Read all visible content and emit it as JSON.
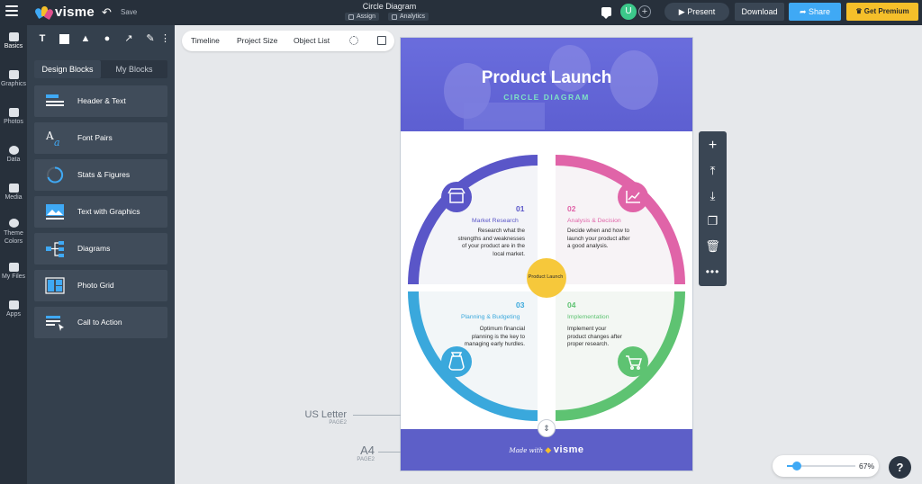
{
  "header": {
    "logo_text": "visme",
    "save_label": "Save",
    "document_title": "Circle Diagram",
    "assign_label": "Assign",
    "analytics_label": "Analytics",
    "avatar_initial": "U",
    "present_label": "Present",
    "download_label": "Download",
    "share_label": "Share",
    "premium_label": "Get Premium"
  },
  "rail": {
    "items": [
      {
        "label": "Basics"
      },
      {
        "label": "Graphics"
      },
      {
        "label": "Photos"
      },
      {
        "label": "Data"
      },
      {
        "label": "Media"
      },
      {
        "label": "Theme Colors"
      },
      {
        "label": "My Files"
      },
      {
        "label": "Apps"
      }
    ]
  },
  "panel": {
    "tab_design_blocks": "Design Blocks",
    "tab_my_blocks": "My Blocks",
    "blocks": [
      {
        "label": "Header & Text",
        "icon": "header-text-icon"
      },
      {
        "label": "Font Pairs",
        "icon": "font-pairs-icon"
      },
      {
        "label": "Stats & Figures",
        "icon": "stats-icon"
      },
      {
        "label": "Text with Graphics",
        "icon": "text-graphics-icon"
      },
      {
        "label": "Diagrams",
        "icon": "diagrams-icon"
      },
      {
        "label": "Photo Grid",
        "icon": "photo-grid-icon"
      },
      {
        "label": "Call to Action",
        "icon": "cta-icon"
      }
    ]
  },
  "context_bar": {
    "timeline": "Timeline",
    "project_size": "Project Size",
    "object_list": "Object List"
  },
  "infographic": {
    "title": "Product Launch",
    "subtitle": "CIRCLE DIAGRAM",
    "center": "Product Launch",
    "quadrants": [
      {
        "num": "01",
        "title": "Market Research",
        "text": "Research what the strengths and weaknesses of your product are in the local market.",
        "color": "#5a56c8",
        "icon": "store-icon"
      },
      {
        "num": "02",
        "title": "Analysis & Decision",
        "text": "Decide when and how to launch your product after a good analysis.",
        "color": "#e064a8",
        "icon": "chart-up-icon"
      },
      {
        "num": "03",
        "title": "Planning & Budgeting",
        "text": "Optimum financial planning is the key to managing early hurdles.",
        "color": "#3aa8dc",
        "icon": "money-bag-icon"
      },
      {
        "num": "04",
        "title": "Implementation",
        "text": "Implement your product changes after proper research.",
        "color": "#5ec372",
        "icon": "cart-icon"
      }
    ],
    "center_color": "#f6c83b",
    "footer_made_with": "Made with",
    "footer_brand": "visme"
  },
  "page_sizes": {
    "us_letter": "US Letter",
    "us_letter_page": "PAGE2",
    "a4": "A4",
    "a4_page": "PAGE2"
  },
  "zoom": {
    "value_label": "67%",
    "level": 0.15
  },
  "help_label": "?",
  "colors": {
    "topbar": "#27303b",
    "panel": "#34404d",
    "share": "#3fa9f5",
    "premium": "#f5bf2a",
    "hero": "#5d5fd1"
  }
}
